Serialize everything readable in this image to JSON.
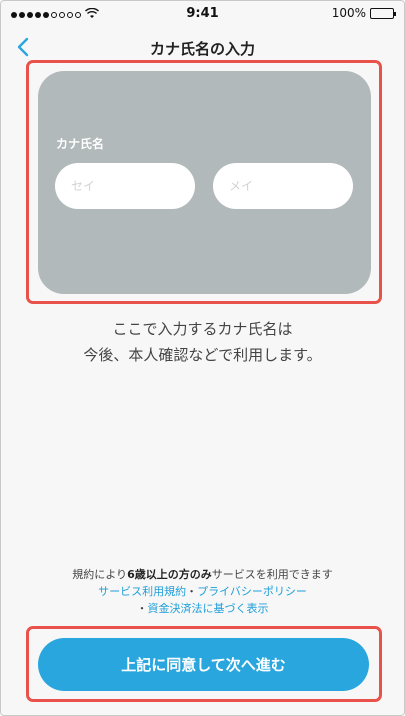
{
  "status_bar": {
    "carrier": "",
    "time": "9:41",
    "battery": "100%"
  },
  "nav": {
    "title": "カナ氏名の入力"
  },
  "form": {
    "label": "カナ氏名",
    "sei_placeholder": "セイ",
    "mei_placeholder": "メイ",
    "sei_value": "",
    "mei_value": ""
  },
  "description": {
    "line1": "ここで入力するカナ氏名は",
    "line2": "今後、本人確認などで利用します。"
  },
  "notes": {
    "age_prefix": "規約により",
    "age_bold": "6歳以上の方のみ",
    "age_suffix": "サービスを利用できます",
    "terms_link": "サービス利用規約",
    "separator1": "・",
    "privacy_link": "プライバシーポリシー",
    "separator2": "・",
    "payment_link": "資金決済法に基づく表示"
  },
  "agree_button": {
    "label": "上記に同意して次へ進む"
  },
  "colors": {
    "accent": "#2aa6df",
    "link": "#1f9ed8",
    "highlight": "#e8524a",
    "card": "#b2b9ba"
  },
  "icons": {
    "back": "chevron-left-icon",
    "wifi": "wifi-icon",
    "battery": "battery-icon"
  }
}
